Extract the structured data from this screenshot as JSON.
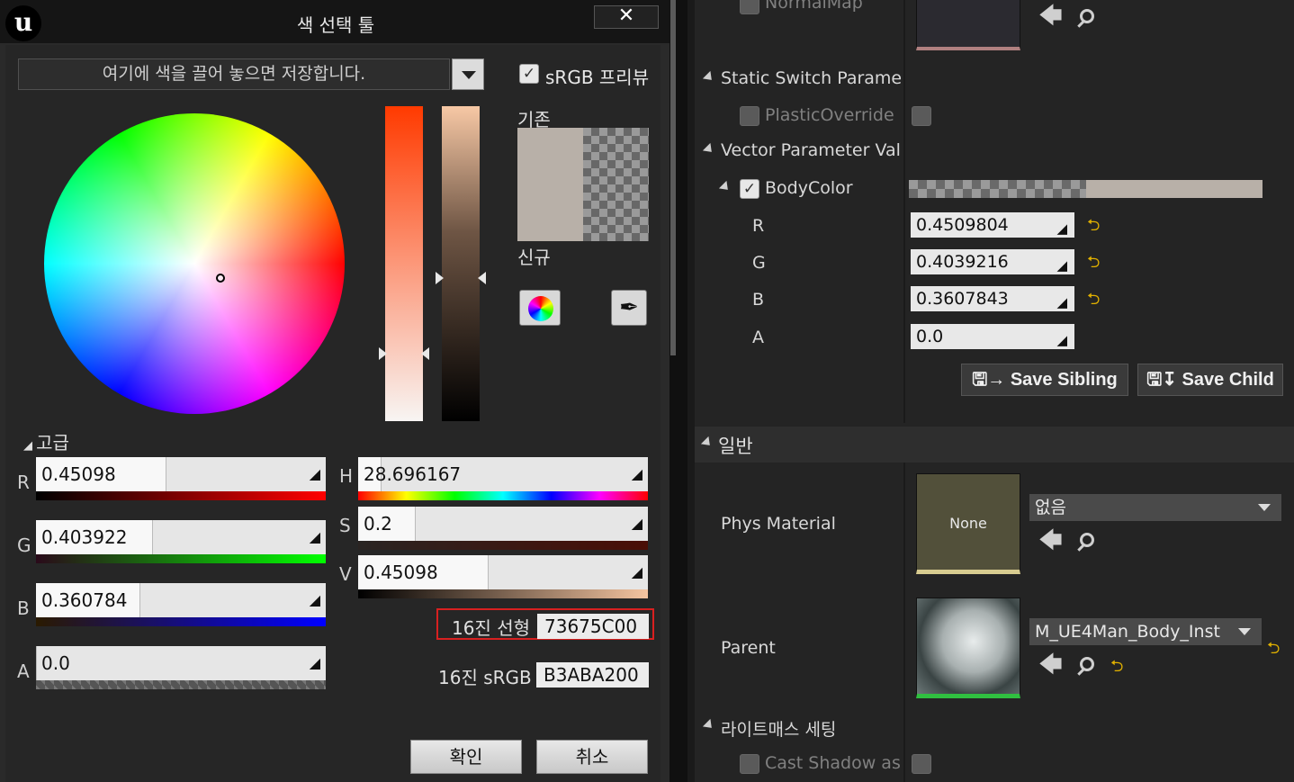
{
  "dialog": {
    "title": "색 선택 툴",
    "close_label": "✕",
    "logo_text": "u",
    "drop_area_text": "여기에 색을 끌어 놓으면 저장합니다.",
    "srgb_preview_label": "sRGB 프리뷰",
    "srgb_preview_checked": true,
    "old_label": "기존",
    "new_label": "신규",
    "current_color": "#B8B0A8",
    "advanced_label": "고급",
    "rgba": [
      {
        "channel": "R",
        "value": "0.45098",
        "fraction": 0.45098
      },
      {
        "channel": "G",
        "value": "0.403922",
        "fraction": 0.403922
      },
      {
        "channel": "B",
        "value": "0.360784",
        "fraction": 0.360784
      },
      {
        "channel": "A",
        "value": "0.0",
        "fraction": 0.0
      }
    ],
    "hsv": [
      {
        "channel": "H",
        "value": "28.696167",
        "fraction": 0.0797
      },
      {
        "channel": "S",
        "value": "0.2",
        "fraction": 0.2
      },
      {
        "channel": "V",
        "value": "0.45098",
        "fraction": 0.45098
      }
    ],
    "hex_linear_label": "16진 선형",
    "hex_linear_value": "73675C00",
    "hex_srgb_label": "16진 sRGB",
    "hex_srgb_value": "B3ABA200",
    "ok_label": "확인",
    "cancel_label": "취소",
    "icons": [
      "color-wheel-icon",
      "eyedropper-icon",
      "dropdown-arrow-icon"
    ]
  },
  "panel": {
    "top_param": "NormalMap",
    "static_switch_header": "Static Switch Paramet",
    "plastic_override_label": "PlasticOverride",
    "vector_header": "Vector Parameter Valu",
    "body_color_label": "BodyColor",
    "body_color_checked": true,
    "body_color_channels": [
      {
        "label": "R",
        "value": "0.4509804",
        "reset": true
      },
      {
        "label": "G",
        "value": "0.4039216",
        "reset": true
      },
      {
        "label": "B",
        "value": "0.3607843",
        "reset": true
      },
      {
        "label": "A",
        "value": "0.0",
        "reset": false
      }
    ],
    "save_sibling_label": "Save Sibling",
    "save_child_label": "Save Child",
    "general_header": "일반",
    "phys_material_label": "Phys Material",
    "phys_material_thumb_text": "None",
    "phys_material_value": "없음",
    "parent_label": "Parent",
    "parent_value": "M_UE4Man_Body_Inst",
    "lightmass_header": "라이트매스 세팅",
    "cast_shadow_label": "Cast Shadow as M"
  }
}
